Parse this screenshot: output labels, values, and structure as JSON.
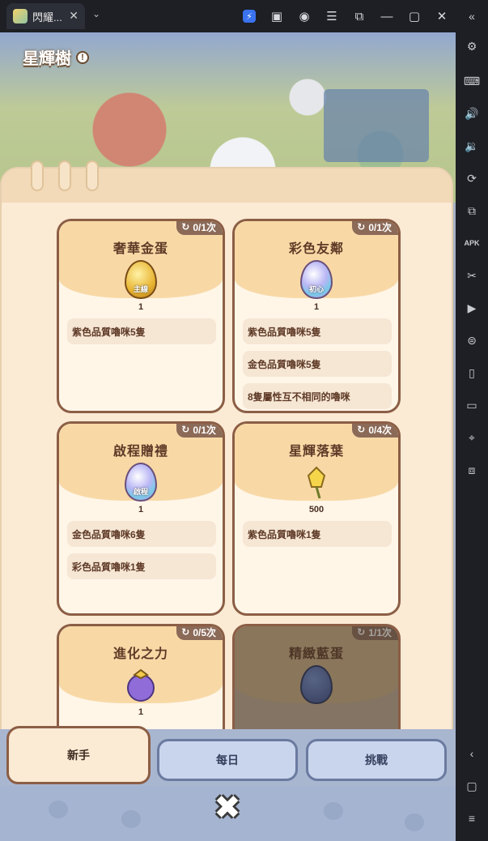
{
  "titlebar": {
    "tab_label": "閃耀...",
    "tab_close": "✕",
    "dropdown": "⌄",
    "icons": [
      "lightning-icon",
      "store-icon",
      "account-icon",
      "menu-icon",
      "screenshot-icon",
      "minimize-icon",
      "maximize-icon",
      "close-icon",
      "collapse-icon"
    ]
  },
  "sidebar": {
    "icons": [
      "settings-icon",
      "keyboard-icon",
      "volume-up-icon",
      "volume-down-icon",
      "rotate-icon",
      "multi-instance-icon",
      "apk-icon",
      "cut-icon",
      "record-icon",
      "macro-icon",
      "shake-icon",
      "folder-icon",
      "location-icon",
      "screenshot-icon",
      "back-icon",
      "home-icon",
      "recent-icon"
    ],
    "apk_label": "APK"
  },
  "scene": {
    "title": "星輝樹",
    "info_symbol": "!"
  },
  "cards": [
    {
      "title": "奢華金蛋",
      "count": "0/1次",
      "egg_type": "gold",
      "egg_label": "主線",
      "qty": "1",
      "requirements": [
        "紫色品質嚕咪5隻"
      ],
      "locked": false
    },
    {
      "title": "彩色友鄰",
      "count": "0/1次",
      "egg_type": "rainbow",
      "egg_label": "初心",
      "qty": "1",
      "requirements": [
        "紫色品質嚕咪5隻",
        "金色品質嚕咪5隻",
        "8隻屬性互不相同的嚕咪"
      ],
      "locked": false
    },
    {
      "title": "啟程贈禮",
      "count": "0/1次",
      "egg_type": "rainbow",
      "egg_label": "啟程",
      "qty": "1",
      "requirements": [
        "金色品質嚕咪6隻",
        "彩色品質嚕咪1隻"
      ],
      "locked": false
    },
    {
      "title": "星輝落葉",
      "count": "0/4次",
      "egg_type": "leaf",
      "egg_label": "",
      "qty": "500",
      "requirements": [
        "紫色品質嚕咪1隻"
      ],
      "locked": false
    },
    {
      "title": "進化之力",
      "count": "0/5次",
      "egg_type": "fruit",
      "egg_label": "",
      "qty": "1",
      "requirements": [],
      "locked": false
    },
    {
      "title": "精緻藍蛋",
      "count": "1/1次",
      "egg_type": "blue",
      "egg_label": "",
      "qty": "",
      "requirements": [],
      "locked": true
    }
  ],
  "tabs": [
    {
      "label": "新手",
      "active": true
    },
    {
      "label": "每日",
      "active": false
    },
    {
      "label": "挑戰",
      "active": false
    }
  ],
  "close_symbol": "✖",
  "refresh_symbol": "↻",
  "colors": {
    "panel_bg": "#fbead4",
    "card_border": "#8b5e45",
    "card_head": "#f8d9a6",
    "count_badge": "#8b6a58"
  }
}
